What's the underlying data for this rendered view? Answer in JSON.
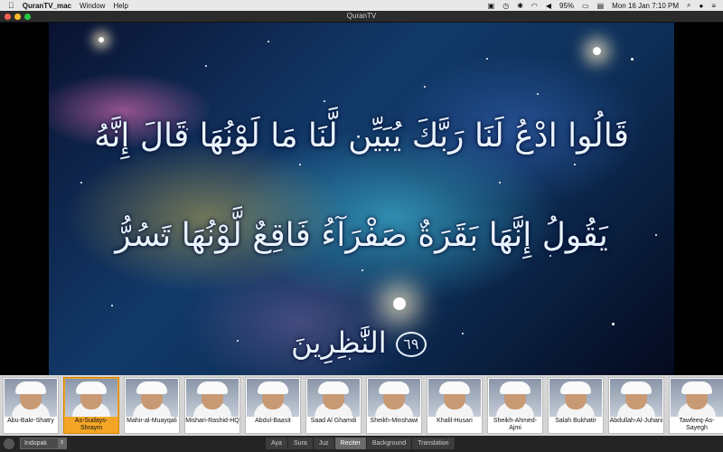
{
  "menubar": {
    "apple": "",
    "app_name": "QuranTV_mac",
    "menus": [
      "Window",
      "Help"
    ],
    "battery": "95%",
    "datetime": "Mon 16 Jan  7:10 PM"
  },
  "window": {
    "title": "QuranTV"
  },
  "verse": {
    "line1": "قَالُوا ادْعُ لَنَا رَبَّكَ يُبَيِّن لَّنَا مَا لَوْنُهَا قَالَ إِنَّهُ",
    "line2": "يَقُولُ إِنَّهَا بَقَرَةٌ صَفْرَآءُ فَاقِعٌ لَّوْنُهَا تَسُرُّ",
    "line3": "النَّٰظِرِينَ",
    "ayah_number": "٦٩"
  },
  "reciters": [
    {
      "name": "Abu-Bakr-Shatry",
      "selected": false
    },
    {
      "name": "As-Sudays-Shraym",
      "selected": true
    },
    {
      "name": "Mahir-al-Muayqali",
      "selected": false
    },
    {
      "name": "Mishari-Rashid-HQ",
      "selected": false
    },
    {
      "name": "Abdul-Baasit",
      "selected": false
    },
    {
      "name": "Saad Al Ghamdi",
      "selected": false
    },
    {
      "name": "Sheikh-Minshawi",
      "selected": false
    },
    {
      "name": "Khalil-Husari",
      "selected": false
    },
    {
      "name": "Sheikh-Ahmed-Ajmi",
      "selected": false
    },
    {
      "name": "Salah Bukhatir",
      "selected": false
    },
    {
      "name": "Abdullah-Al-Juhani",
      "selected": false
    },
    {
      "name": "Tawfeeq-As-Sayegh",
      "selected": false
    }
  ],
  "bottombar": {
    "script_select": "Indopak",
    "tabs": [
      "Aya",
      "Sura",
      "Juz",
      "Reciter",
      "Background",
      "Translation"
    ],
    "active_tab": "Reciter"
  },
  "colors": {
    "selected_reciter": "#f3a626",
    "close": "#ff5f57",
    "minimize": "#febc2e",
    "zoom": "#28c840"
  }
}
